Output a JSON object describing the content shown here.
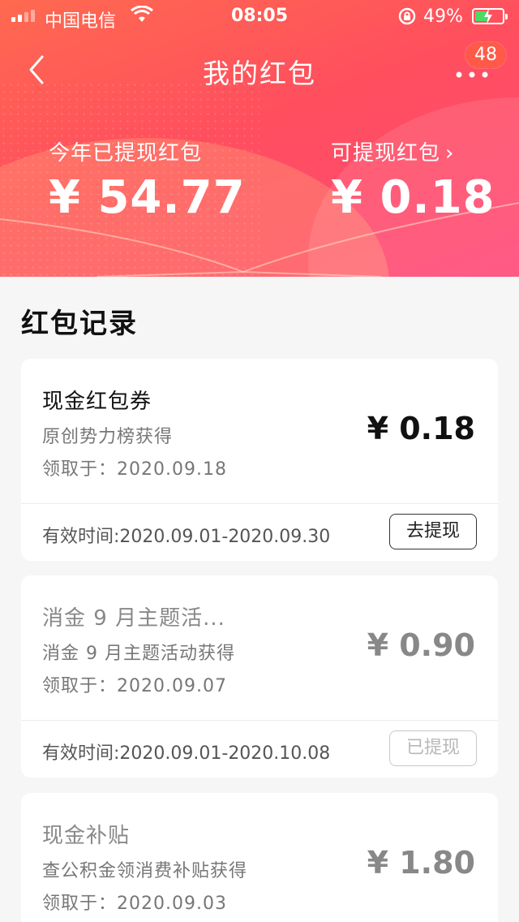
{
  "status_bar": {
    "carrier": "中国电信",
    "time": "08:05",
    "battery_percent": "49%",
    "battery_level": 0.49,
    "battery_color": "#4cd964"
  },
  "nav": {
    "title": "我的红包",
    "back_icon": "chevron-left-icon",
    "more_icon": "more-dots-icon",
    "badge": "48"
  },
  "summary": {
    "withdrawn_label": "今年已提现红包",
    "withdrawn_value": "¥ 54.77",
    "available_label": "可提现红包",
    "available_chevron": "›",
    "available_value": "¥ 0.18"
  },
  "records": {
    "title": "红包记录",
    "items": [
      {
        "name": "现金红包券",
        "source": "原创势力榜获得",
        "date": "领取于：2020.09.18",
        "amount": "¥ 0.18",
        "validity": "有效时间:2020.09.01-2020.09.30",
        "button": "去提现",
        "state": "active"
      },
      {
        "name": "消金 9 月主题活...",
        "source": "消金 9 月主题活动获得",
        "date": "领取于：2020.09.07",
        "amount": "¥ 0.90",
        "validity": "有效时间:2020.09.01-2020.10.08",
        "button": "已提现",
        "state": "used"
      },
      {
        "name": "现金补贴",
        "source": "查公积金领消费补贴获得",
        "date": "领取于：2020.09.03",
        "amount": "¥ 1.80"
      }
    ]
  },
  "colors": {
    "header_start": "#ff6a4f",
    "header_end": "#ff4878",
    "badge": "#ff5a48"
  }
}
